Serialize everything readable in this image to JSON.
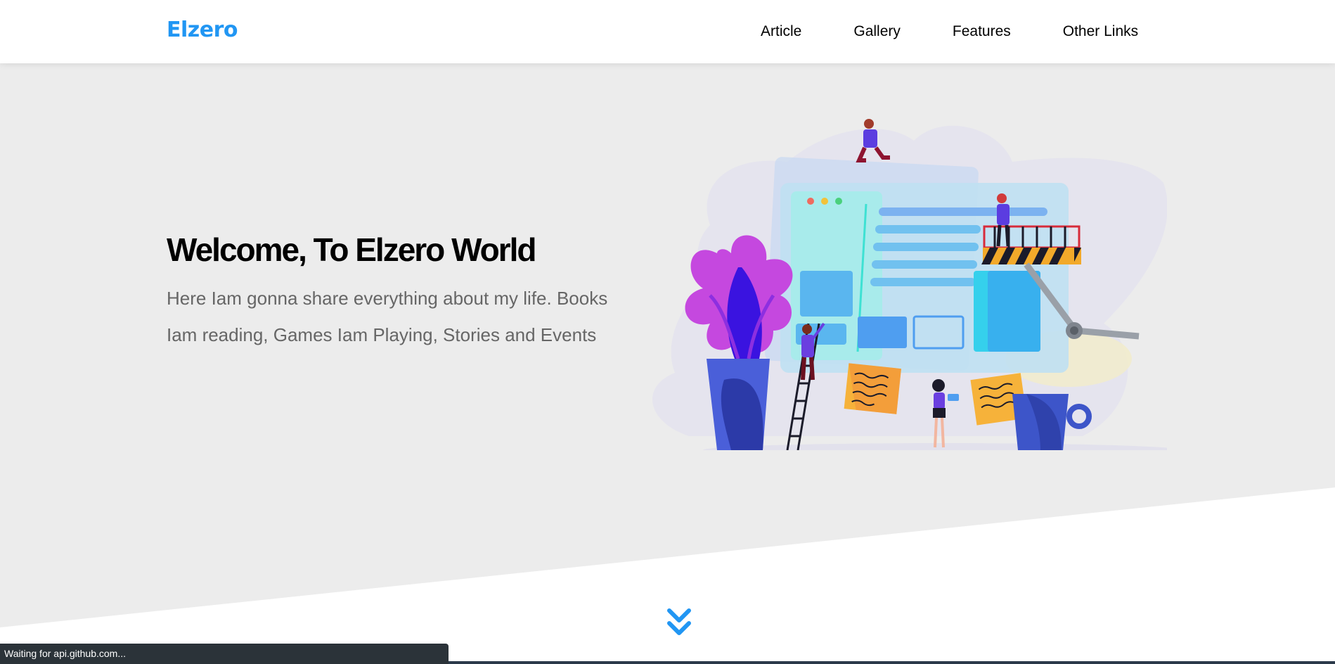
{
  "header": {
    "logo": "Elzero",
    "nav": [
      {
        "label": "Article"
      },
      {
        "label": "Gallery"
      },
      {
        "label": "Features"
      },
      {
        "label": "Other Links"
      }
    ]
  },
  "landing": {
    "title": "Welcome, To Elzero World",
    "description": "Here Iam gonna share everything about my life. Books Iam reading, Games Iam Playing, Stories and Events",
    "illustration": "web-design-team-illustration",
    "go_down_icon": "double-chevron-down-icon"
  },
  "status_bar": {
    "text": "Waiting for api.github.com..."
  },
  "colors": {
    "accent": "#2196f3",
    "landing_bg": "#ececec",
    "text_muted": "#666666",
    "status_bg": "#2b3339"
  }
}
